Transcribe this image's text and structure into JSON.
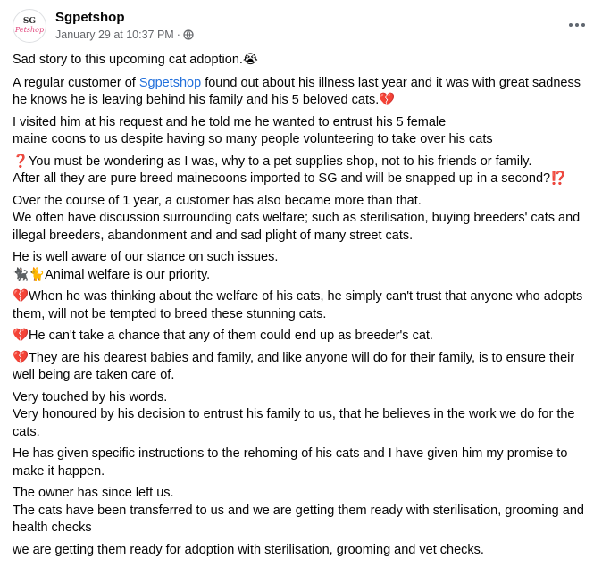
{
  "post": {
    "avatar_text_1": "SG",
    "avatar_text_2": "Petshop",
    "page_name": "Sgpetshop",
    "timestamp": "January 29 at 10:37 PM",
    "separator": "·",
    "privacy_icon": "globe-icon",
    "more_icon": "more-options-icon",
    "paragraphs": [
      "Sad story to this upcoming cat adoption.😭",
      "A regular customer of |Sgpetshop| found out about his illness last year and it was with great sadness he knows he is leaving behind his family and his 5 beloved cats.💔",
      "I visited him at his request and he told me he wanted  to entrust his 5 female\nmaine coons to us despite having so many people volunteering to take over his cats",
      "❓You must be wondering as I was, why to a pet supplies shop,  not to his friends or family.\nAfter all they are pure breed mainecoons imported to SG  and will be snapped up in a second?⁉️",
      "Over the course of 1 year, a customer has also became more than that.\nWe often have discussion surrounding cats welfare; such as sterilisation,  buying breeders' cats and illegal breeders, abandonment and and sad plight of many street cats.",
      "He is well aware of our stance on such issues.\n🐈‍⬛🐈Animal welfare is our priority.",
      "💔When he was thinking about the welfare of his cats, he simply can't trust that anyone who adopts them, will not be tempted to breed these stunning cats.",
      "💔He can't take a chance that any of them could end up as  breeder's cat.",
      "💔They are his dearest babies and family,  and like anyone will do for their family,  is to ensure their well being are taken care of.",
      "Very touched by his words.\nVery honoured by his decision to entrust his family to us, that he believes in the work we do for the cats.",
      "He has given specific instructions to the rehoming of his cats and I have given him my promise to make it happen.",
      "The owner has since left us.\nThe cats have been transferred to us and we are getting them ready with sterilisation, grooming and health checks",
      "we are getting them ready for adoption with sterilisation,  grooming and vet checks."
    ],
    "paragraph_2_prefix": "A regular customer of ",
    "paragraph_2_link": "Sgpetshop",
    "paragraph_2_suffix": " found out about his illness last year and it was with great sadness he knows he is leaving behind his family and his 5 beloved cats.💔"
  },
  "colors": {
    "link": "#216fdb",
    "meta": "#65676b",
    "text": "#050505"
  }
}
